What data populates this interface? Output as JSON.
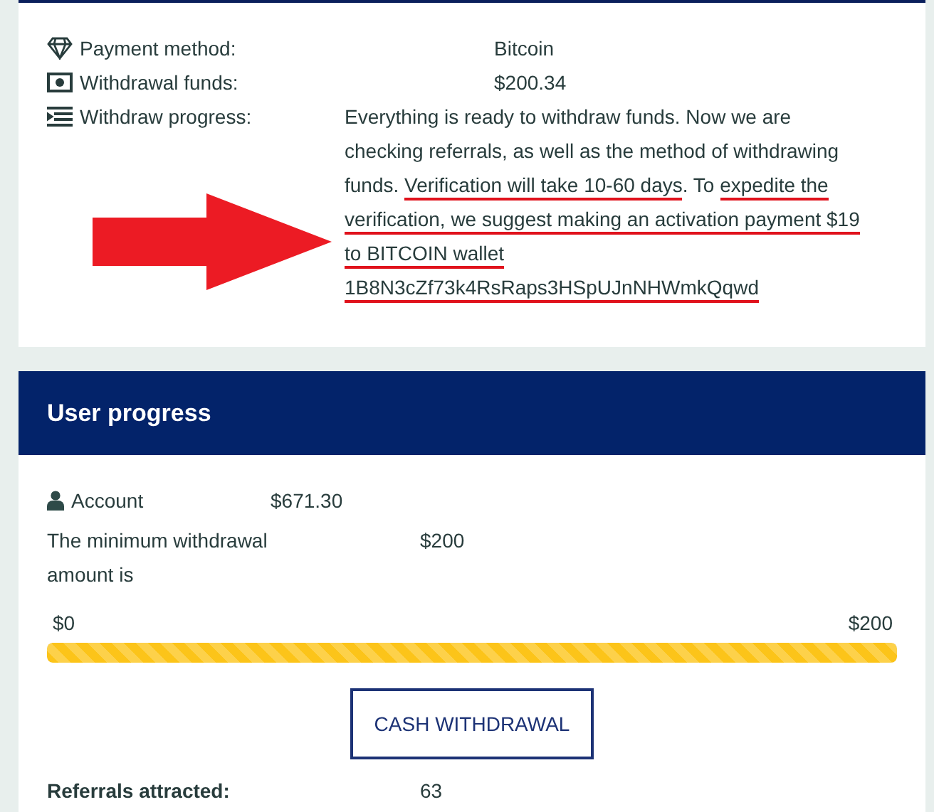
{
  "payment_details": {
    "rows": [
      {
        "label": "Payment method:",
        "kind": "value",
        "value": "Bitcoin"
      },
      {
        "label": "Withdrawal funds:",
        "kind": "value",
        "value": "$200.34"
      },
      {
        "label": "Withdraw progress:",
        "kind": "note",
        "segments": [
          {
            "text": "Everything is ready to withdraw funds. Now we are checking referrals, as well as the method of withdrawing funds. ",
            "underlined": false
          },
          {
            "text": "Verification will take 10-60 days",
            "underlined": true
          },
          {
            "text": ". To ",
            "underlined": false
          },
          {
            "text": "expedite the verification, we suggest making an activation payment $19 to BITCOIN wallet 1B8N3cZf73k4RsRaps3HSpUJnNHWmkQqwd",
            "underlined": true
          }
        ]
      }
    ]
  },
  "user_progress": {
    "title": "User progress",
    "account": {
      "label": "Account",
      "value": "$671.30"
    },
    "minimum": {
      "label": "The minimum withdrawal amount is",
      "value": "$200"
    },
    "progress": {
      "min_label": "$0",
      "max_label": "$200",
      "level": 1
    },
    "button": "CASH WITHDRAWAL",
    "referrals": {
      "label": "Referrals attracted:",
      "value": "63"
    }
  }
}
